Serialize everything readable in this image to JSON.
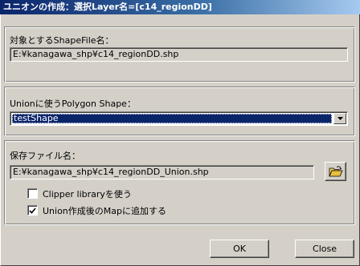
{
  "window": {
    "title": "ユニオンの作成：選択Layer名=[c14_regionDD]"
  },
  "target_group": {
    "label": "対象とするShapeFile名：",
    "value": "E:¥kanagawa_shp¥c14_regionDD.shp"
  },
  "polygon_group": {
    "label": "Unionに使うPolygon Shape：",
    "selected": "testShape"
  },
  "save_group": {
    "label": "保存ファイル名：",
    "value": "E:¥kanagawa_shp¥c14_regionDD_Union.shp",
    "clipper_label": "Clipper libraryを使う",
    "clipper_checked": false,
    "addmap_label": "Union作成後のMapに追加する",
    "addmap_checked": true,
    "browse_icon": "open-folder-icon"
  },
  "buttons": {
    "ok": "OK",
    "close": "Close"
  }
}
